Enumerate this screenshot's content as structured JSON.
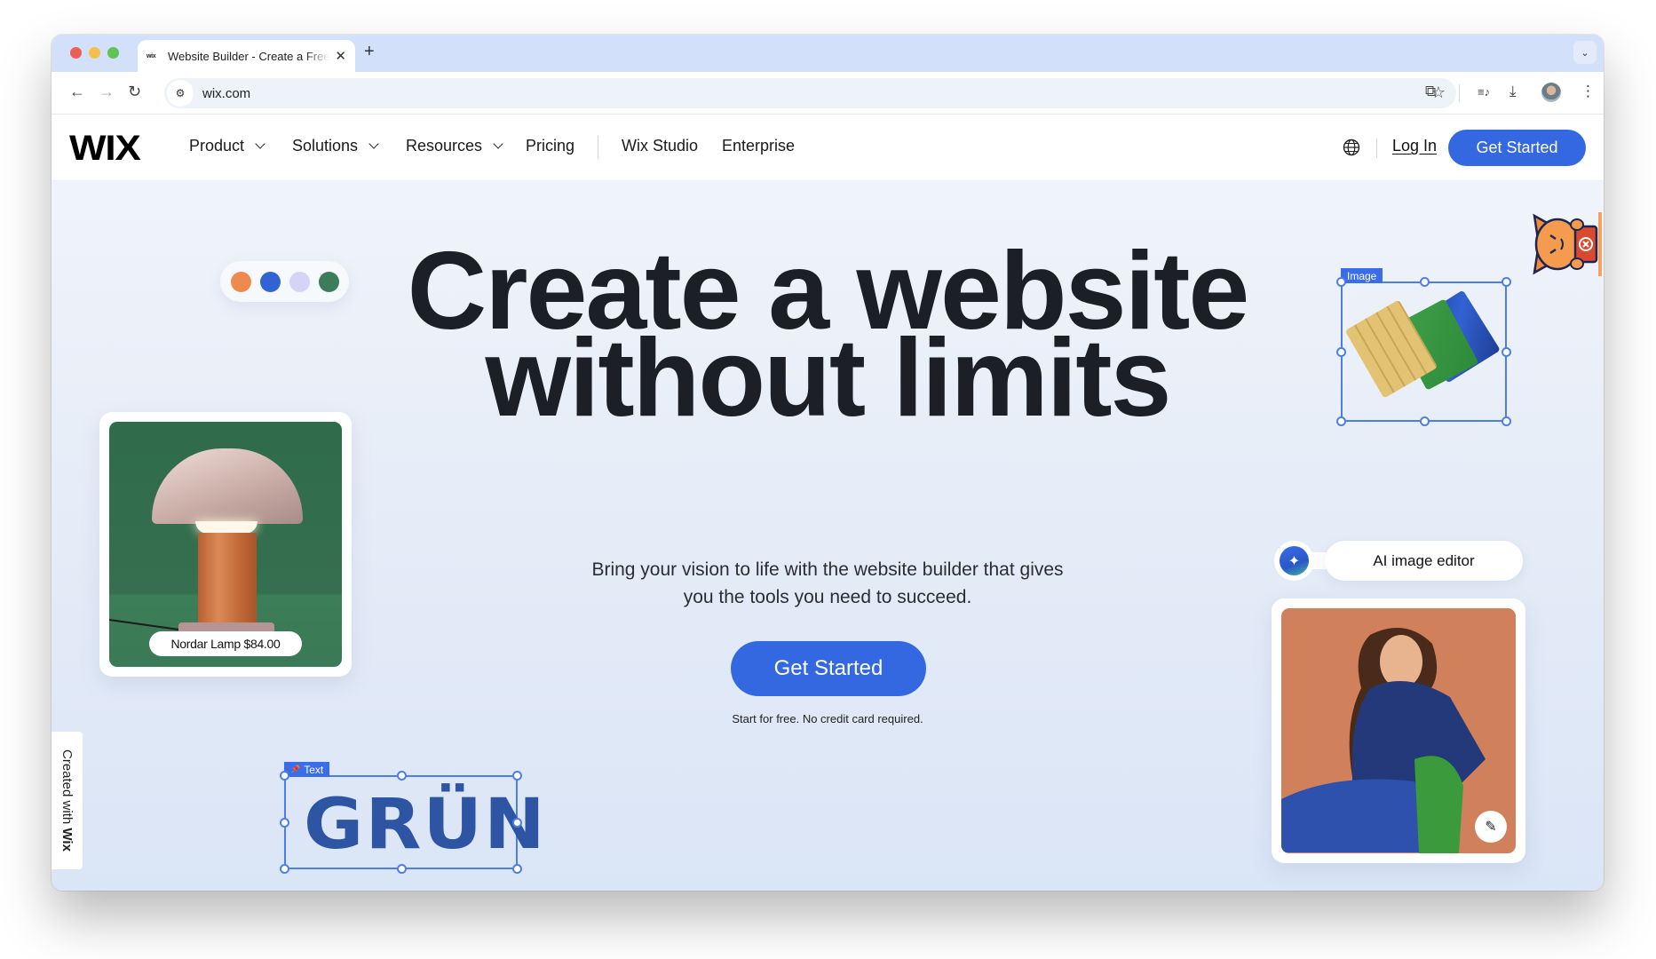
{
  "browser": {
    "tab": {
      "favicon": "wix",
      "title": "Website Builder - Create a Free Website",
      "close_icon": "✕"
    },
    "new_tab_icon": "+",
    "tab_menu_icon": "⌄",
    "nav": {
      "back": "←",
      "forward": "→",
      "reload": "↻"
    },
    "omnibox": {
      "site_info_icon": "⚙",
      "url": "wix.com",
      "bookmark_icon": "☆"
    },
    "toolbar_icons": {
      "extensions": "⧉",
      "media": "≡♪",
      "download": "⤓",
      "menu": "⋮"
    }
  },
  "site": {
    "logo": "WIX",
    "nav": [
      {
        "label": "Product",
        "has_dropdown": true
      },
      {
        "label": "Solutions",
        "has_dropdown": true
      },
      {
        "label": "Resources",
        "has_dropdown": true
      },
      {
        "label": "Pricing",
        "has_dropdown": false
      },
      {
        "label": "Wix Studio",
        "has_dropdown": false
      },
      {
        "label": "Enterprise",
        "has_dropdown": false
      }
    ],
    "login": "Log In",
    "header_cta": "Get Started"
  },
  "hero": {
    "title_line1": "Create a website",
    "title_line2": "without limits",
    "subtitle": "Bring your vision to life with the website builder that gives you the tools you need to succeed.",
    "cta": "Get Started",
    "note": "Start for free. No credit card required."
  },
  "decor": {
    "swatches": [
      "#ee8a4f",
      "#3262d3",
      "#d5d3f6",
      "#3c7c5a"
    ],
    "lamp_label": "Nordar Lamp $84.00",
    "image_tag": "Image",
    "text_tag": "Text",
    "text_tag_icon": "📌",
    "grun_text": "GRÜN",
    "ai_label": "AI image editor",
    "ai_icon": "✦",
    "edit_icon": "✎",
    "badge_prefix": "Created with ",
    "badge_brand": "Wix"
  },
  "colors": {
    "accent": "#3468e0",
    "selection": "#4d7ee8",
    "heading": "#1c1f26"
  }
}
